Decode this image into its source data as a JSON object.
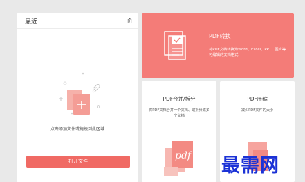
{
  "recent": {
    "title": "最近",
    "drop_hint": "点击添加文件或拖拽到此区域",
    "open_button": "打开文件"
  },
  "convert": {
    "title": "PDF转换",
    "description": "将PDF文档转换为Word、Excel、PPT、图片等可编辑的文档格式"
  },
  "merge": {
    "title": "PDF合并/拆分",
    "description": "将PDF文档合并一个文档、或拆分成多个文档"
  },
  "compress": {
    "title": "PDF压缩",
    "description": "减少PDF文件的大小"
  },
  "watermark": "最需网",
  "colors": {
    "accent": "#f06a64",
    "banner": "#f47c78"
  }
}
